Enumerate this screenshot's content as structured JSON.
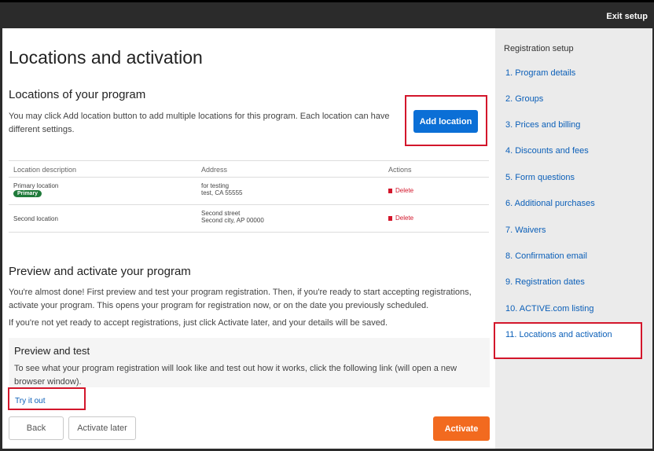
{
  "topbar": {
    "exit_label": "Exit setup"
  },
  "main": {
    "title": "Locations and activation",
    "locations": {
      "heading": "Locations of your program",
      "description": "You may click Add location button to add multiple locations for this program. Each location can have different settings.",
      "add_button": "Add location",
      "table": {
        "headers": [
          "Location description",
          "Address",
          "Actions"
        ],
        "rows": [
          {
            "description": "Primary location",
            "badge": "Primary",
            "address1": "for testing",
            "address2": "test, CA 55555",
            "action": "Delete"
          },
          {
            "description": "Second location",
            "badge": "",
            "address1": "Second street",
            "address2": "Second city, AP 00000",
            "action": "Delete"
          }
        ]
      }
    },
    "preview": {
      "heading": "Preview and activate your program",
      "p1": "You're almost done! First preview and test your program registration. Then, if you're ready to start accepting registrations, activate your program. This opens your program for registration now, or on the date you previously scheduled.",
      "p2": "If you're not yet ready to accept registrations, just click Activate later, and your details will be saved.",
      "test_heading": "Preview and test",
      "test_text": "To see what your program registration will look like and test out how it works, click the following link (will open a new browser window).",
      "try_link": "Try it out"
    },
    "footer": {
      "back": "Back",
      "activate_later": "Activate later",
      "activate": "Activate"
    }
  },
  "sidebar": {
    "heading": "Registration setup",
    "items": [
      "1. Program details",
      "2. Groups",
      "3. Prices and billing",
      "4. Discounts and fees",
      "5. Form questions",
      "6. Additional purchases",
      "7. Waivers",
      "8. Confirmation email",
      "9. Registration dates",
      "10. ACTIVE.com listing",
      "11. Locations and activation"
    ],
    "active_index": 10
  },
  "colors": {
    "primary_button": "#0b6fd6",
    "activate_button": "#f26a1f",
    "highlight_box": "#d3162b",
    "primary_badge": "#1f7a3a"
  }
}
